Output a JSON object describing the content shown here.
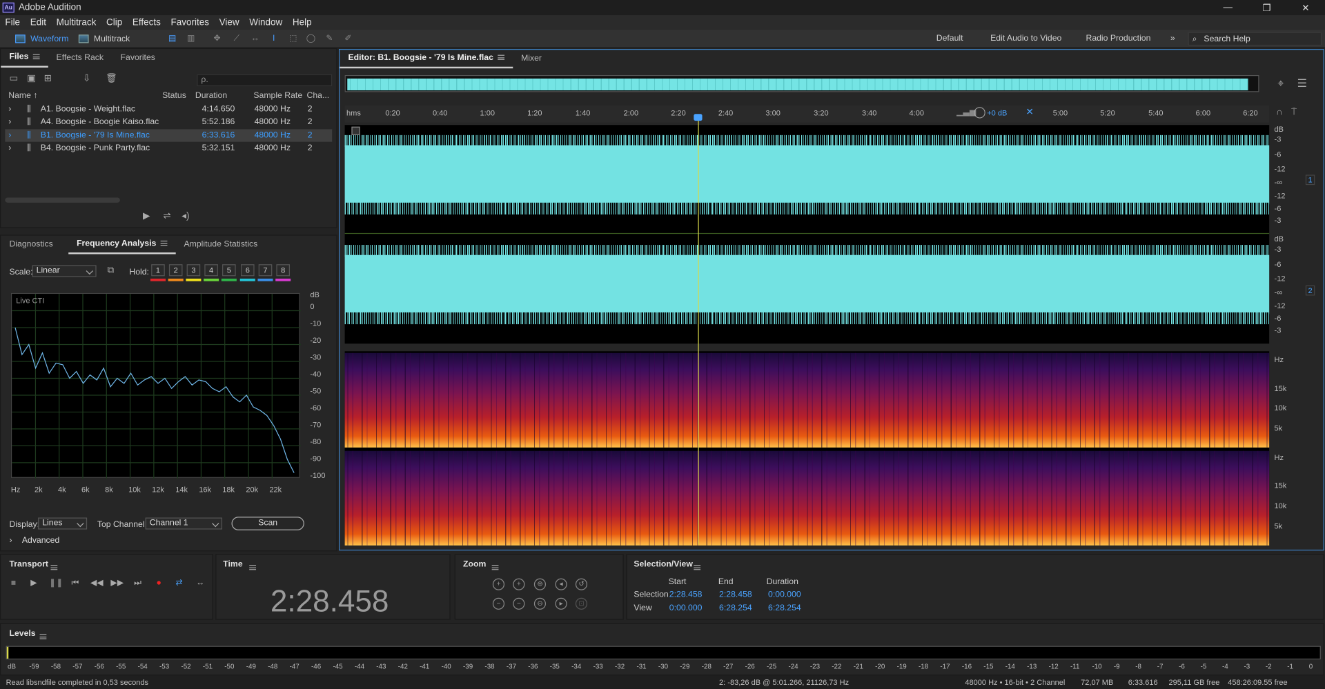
{
  "app": {
    "title": "Adobe Audition",
    "logo": "Au",
    "window_controls": [
      "—",
      "❐",
      "✕"
    ]
  },
  "menu": [
    "File",
    "Edit",
    "Multitrack",
    "Clip",
    "Effects",
    "Favorites",
    "View",
    "Window",
    "Help"
  ],
  "toolbar": {
    "waveform": "Waveform",
    "multitrack": "Multitrack",
    "workspaces": [
      "Default",
      "Edit Audio to Video",
      "Radio Production"
    ],
    "more": "»",
    "search_help": "Search Help"
  },
  "files_panel": {
    "tabs": [
      "Files",
      "Effects Rack",
      "Favorites"
    ],
    "search_placeholder": "ρ.",
    "columns": [
      "Name ↑",
      "Status",
      "Duration",
      "Sample Rate",
      "Cha..."
    ],
    "rows": [
      {
        "name": "A1. Boogsie - Weight.flac",
        "duration": "4:14.650",
        "rate": "48000 Hz",
        "ch": "2"
      },
      {
        "name": "A4. Boogsie - Boogie Kaiso.flac",
        "duration": "5:52.186",
        "rate": "48000 Hz",
        "ch": "2"
      },
      {
        "name": "B1. Boogsie - '79 Is Mine.flac",
        "duration": "6:33.616",
        "rate": "48000 Hz",
        "ch": "2"
      },
      {
        "name": "B4. Boogsie - Punk Party.flac",
        "duration": "5:32.151",
        "rate": "48000 Hz",
        "ch": "2"
      }
    ]
  },
  "freq_panel": {
    "tabs": [
      "Diagnostics",
      "Frequency Analysis",
      "Amplitude Statistics"
    ],
    "scale_label": "Scale:",
    "scale_value": "Linear",
    "hold_label": "Hold:",
    "holds": [
      "1",
      "2",
      "3",
      "4",
      "5",
      "6",
      "7",
      "8"
    ],
    "hold_colors": [
      "#e0262b",
      "#f08a1c",
      "#f0e01c",
      "#6ad43a",
      "#2fb54a",
      "#24c4d8",
      "#3a8fe8",
      "#d83ad0"
    ],
    "live_cti": "Live CTI",
    "db_unit": "dB",
    "db_ticks": [
      "0",
      "-10",
      "-20",
      "-30",
      "-40",
      "-50",
      "-60",
      "-70",
      "-80",
      "-90",
      "-100"
    ],
    "hz_ticks": [
      "Hz",
      "2k",
      "4k",
      "6k",
      "8k",
      "10k",
      "12k",
      "14k",
      "16k",
      "18k",
      "20k",
      "22k"
    ],
    "display_label": "Display:",
    "display_value": "Lines",
    "top_channel_label": "Top Channel:",
    "top_channel_value": "Channel 1",
    "scan": "Scan",
    "advanced": "Advanced",
    "spectrum_db": [
      -14,
      -30,
      -24,
      -38,
      -29,
      -41,
      -35,
      -36,
      -44,
      -40,
      -47,
      -42,
      -45,
      -38,
      -49,
      -44,
      -47,
      -41,
      -48,
      -45,
      -43,
      -47,
      -44,
      -50,
      -46,
      -43,
      -48,
      -45,
      -46,
      -50,
      -52,
      -49,
      -55,
      -58,
      -54,
      -61,
      -63,
      -66,
      -72,
      -80,
      -92,
      -100
    ]
  },
  "editor": {
    "tab": "Editor: B1. Boogsie - '79 Is Mine.flac",
    "mixer": "Mixer",
    "ruler": [
      "hms",
      "0:20",
      "0:40",
      "1:00",
      "1:20",
      "1:40",
      "2:00",
      "2:20",
      "2:40",
      "3:00",
      "3:20",
      "3:40",
      "4:00",
      "5:00",
      "5:20",
      "5:40",
      "6:00",
      "6:20"
    ],
    "gain": "+0 dB",
    "db_scale": [
      "dB",
      "-3",
      "-6",
      "-12",
      "-∞",
      "-12",
      "-6",
      "-3"
    ],
    "channels": [
      "1",
      "2"
    ],
    "hz_scale_top": [
      "Hz",
      "15k",
      "10k",
      "5k"
    ],
    "hz_scale_bottom": [
      "Hz",
      "15k",
      "10k",
      "5k"
    ]
  },
  "transport": {
    "title": "Transport",
    "buttons": [
      "■",
      "▶",
      "❚❚",
      "⏮",
      "◀◀",
      "▶▶",
      "⏭",
      "●",
      "⇄",
      "↔"
    ]
  },
  "time": {
    "title": "Time",
    "value": "2:28.458"
  },
  "zoom": {
    "title": "Zoom"
  },
  "selection_view": {
    "title": "Selection/View",
    "start": "Start",
    "end": "End",
    "duration": "Duration",
    "selection_label": "Selection",
    "view_label": "View",
    "selection_start": "2:28.458",
    "selection_end": "2:28.458",
    "selection_duration": "0:00.000",
    "view_start": "0:00.000",
    "view_end": "6:28.254",
    "view_duration": "6:28.254"
  },
  "levels": {
    "title": "Levels",
    "ticks": [
      "dB",
      "-59",
      "-58",
      "-57",
      "-56",
      "-55",
      "-54",
      "-53",
      "-52",
      "-51",
      "-50",
      "-49",
      "-48",
      "-47",
      "-46",
      "-45",
      "-44",
      "-43",
      "-42",
      "-41",
      "-40",
      "-39",
      "-38",
      "-37",
      "-36",
      "-35",
      "-34",
      "-33",
      "-32",
      "-31",
      "-30",
      "-29",
      "-28",
      "-27",
      "-26",
      "-25",
      "-24",
      "-23",
      "-22",
      "-21",
      "-20",
      "-19",
      "-18",
      "-17",
      "-16",
      "-15",
      "-14",
      "-13",
      "-12",
      "-11",
      "-10",
      "-9",
      "-8",
      "-7",
      "-6",
      "-5",
      "-4",
      "-3",
      "-2",
      "-1",
      "0"
    ]
  },
  "status": {
    "message": "Read libsndfile completed in 0,53 seconds",
    "cursor": "2: -83,26 dB @ 5:01.266, 21126,73 Hz",
    "format": "48000 Hz • 16-bit • 2 Channel",
    "size": "72,07 MB",
    "duration": "6:33.616",
    "free": "295,11 GB free",
    "free_time": "458:26:09.55 free"
  }
}
